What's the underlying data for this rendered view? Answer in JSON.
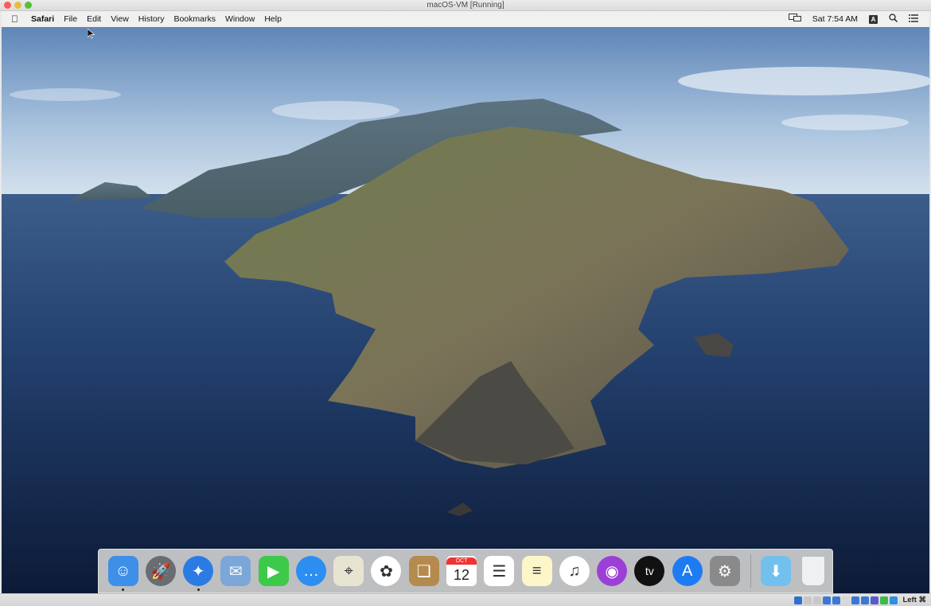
{
  "host_window": {
    "title": "macOS-VM [Running]",
    "traffic_lights": [
      "close",
      "minimize",
      "zoom"
    ]
  },
  "menubar": {
    "apple_icon": "apple-logo-icon",
    "app_name": "Safari",
    "items": [
      "File",
      "Edit",
      "View",
      "History",
      "Bookmarks",
      "Window",
      "Help"
    ],
    "status": {
      "airplay_icon": "display-mirroring-icon",
      "clock": "Sat 7:54 AM",
      "input_source": "A",
      "spotlight_icon": "search-icon",
      "notification_icon": "list-icon"
    }
  },
  "wallpaper": {
    "description": "macOS Catalina island wallpaper"
  },
  "dock": {
    "apps": [
      {
        "name": "Finder",
        "icon": "finder-icon",
        "running": true,
        "color": "#3d8fe8",
        "glyph": "☺"
      },
      {
        "name": "Launchpad",
        "icon": "launchpad-rocket-icon",
        "running": false,
        "color": "#6a6d70",
        "glyph": "🚀"
      },
      {
        "name": "Safari",
        "icon": "safari-compass-icon",
        "running": true,
        "color": "#2a7be4",
        "glyph": "✦"
      },
      {
        "name": "Mail",
        "icon": "mail-stamp-icon",
        "running": false,
        "color": "#7ba7d8",
        "glyph": "✉"
      },
      {
        "name": "FaceTime",
        "icon": "facetime-icon",
        "running": false,
        "color": "#3dc94a",
        "glyph": "▶"
      },
      {
        "name": "Messages",
        "icon": "messages-icon",
        "running": false,
        "color": "#2d8ef2",
        "glyph": "…"
      },
      {
        "name": "Maps",
        "icon": "maps-icon",
        "running": false,
        "color": "#e8e4d2",
        "glyph": "⌖"
      },
      {
        "name": "Photos",
        "icon": "photos-icon",
        "running": false,
        "color": "#ffffff",
        "glyph": "✿"
      },
      {
        "name": "Contacts",
        "icon": "contacts-book-icon",
        "running": false,
        "color": "#b58a4e",
        "glyph": "❑"
      },
      {
        "name": "Calendar",
        "icon": "calendar-icon",
        "running": false,
        "color": "#ffffff",
        "glyph": "12",
        "month": "OCT"
      },
      {
        "name": "Reminders",
        "icon": "reminders-icon",
        "running": false,
        "color": "#ffffff",
        "glyph": "☰"
      },
      {
        "name": "Notes",
        "icon": "notes-icon",
        "running": false,
        "color": "#fdf6c8",
        "glyph": "≡"
      },
      {
        "name": "Music",
        "icon": "music-note-icon",
        "running": false,
        "color": "#ffffff",
        "glyph": "♫"
      },
      {
        "name": "Podcasts",
        "icon": "podcasts-icon",
        "running": false,
        "color": "#9b3fd6",
        "glyph": "◉"
      },
      {
        "name": "TV",
        "icon": "apple-tv-icon",
        "running": false,
        "color": "#111111",
        "glyph": "tv"
      },
      {
        "name": "App Store",
        "icon": "app-store-icon",
        "running": false,
        "color": "#1e7cf2",
        "glyph": "A"
      },
      {
        "name": "System Preferences",
        "icon": "gear-icon",
        "running": false,
        "color": "#8a8a8a",
        "glyph": "⚙"
      }
    ],
    "others": [
      {
        "name": "Downloads",
        "icon": "downloads-folder-icon",
        "color": "#72c0ee",
        "glyph": "⬇"
      },
      {
        "name": "Trash",
        "icon": "trash-icon",
        "color": "#eef0f2",
        "glyph": ""
      }
    ]
  },
  "host_statusbar": {
    "icons": [
      "hard-disk-icon",
      "optical-drive-icon",
      "audio-icon",
      "network-icon",
      "usb-icon",
      "shared-folder-icon",
      "display-icon",
      "video-capture-icon",
      "vm-icon",
      "green-arrow-icon",
      "cpu-icon"
    ],
    "host_key": "Left ⌘"
  }
}
